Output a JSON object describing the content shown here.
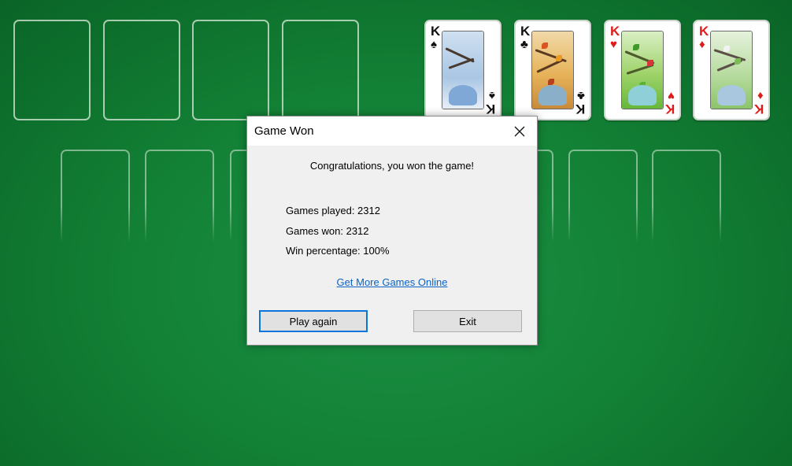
{
  "foundations": {
    "cards": [
      {
        "rank": "K",
        "suit": "♠",
        "suit_name": "spades",
        "color": "black"
      },
      {
        "rank": "K",
        "suit": "♣",
        "suit_name": "clubs",
        "color": "black"
      },
      {
        "rank": "K",
        "suit": "♥",
        "suit_name": "hearts",
        "color": "red"
      },
      {
        "rank": "K",
        "suit": "♦",
        "suit_name": "diamonds",
        "color": "red"
      }
    ]
  },
  "dialog": {
    "title": "Game Won",
    "close_icon": "close-icon",
    "message": "Congratulations, you won the game!",
    "stats": {
      "played": "Games played: 2312",
      "won": "Games won: 2312",
      "percentage": "Win percentage: 100%"
    },
    "link_label": "Get More Games Online",
    "play_again_label": "Play again",
    "exit_label": "Exit"
  },
  "colors": {
    "felt": "#138236",
    "link": "#0b63c4",
    "default_button_border": "#0a74da",
    "red_suit": "#e01b1b"
  }
}
